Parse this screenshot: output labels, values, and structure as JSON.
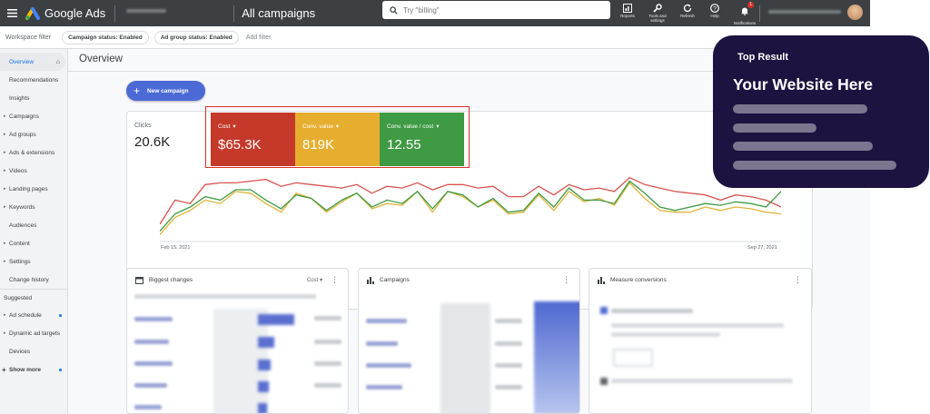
{
  "header": {
    "brand": "Google Ads",
    "page_title": "All campaigns",
    "search_placeholder": "Try \"billing\"",
    "tools": [
      {
        "label": "Reports",
        "icon": "reports-icon"
      },
      {
        "label": "Tools and settings",
        "icon": "wrench-icon"
      },
      {
        "label": "Refresh",
        "icon": "refresh-icon"
      },
      {
        "label": "Help",
        "icon": "help-icon"
      },
      {
        "label": "Notifications",
        "icon": "bell-icon",
        "badge": "1"
      }
    ]
  },
  "filters": {
    "workspace_label": "Workspace filter",
    "chips": [
      "Campaign status: Enabled",
      "Ad group status: Enabled"
    ],
    "add_filter": "Add filter"
  },
  "sidebar": {
    "items": [
      {
        "label": "Overview",
        "selected": true
      },
      {
        "label": "Recommendations"
      },
      {
        "label": "Insights"
      },
      {
        "label": "Campaigns",
        "expandable": true
      },
      {
        "label": "Ad groups",
        "expandable": true
      },
      {
        "label": "Ads & extensions",
        "expandable": true
      },
      {
        "label": "Videos",
        "expandable": true
      },
      {
        "label": "Landing pages",
        "expandable": true
      },
      {
        "label": "Keywords",
        "expandable": true
      },
      {
        "label": "Audiences"
      },
      {
        "label": "Content",
        "expandable": true
      },
      {
        "label": "Settings",
        "expandable": true
      },
      {
        "label": "Change history"
      }
    ],
    "suggested_label": "Suggested",
    "suggested": [
      {
        "label": "Ad schedule",
        "expandable": true
      },
      {
        "label": "Dynamic ad targets",
        "expandable": true
      },
      {
        "label": "Devices"
      }
    ],
    "show_more": "Show more"
  },
  "main": {
    "title": "Overview",
    "new_campaign": "New campaign",
    "clicks": {
      "label": "Clicks",
      "value": "20.6K"
    },
    "metrics": [
      {
        "label": "Cost",
        "value": "$65.3K",
        "color": "#c5392a"
      },
      {
        "label": "Conv. value",
        "value": "819K",
        "color": "#e6ae2f"
      },
      {
        "label": "Conv. value / cost",
        "value": "12.55",
        "color": "#3e9a43"
      }
    ],
    "date_start": "Feb 15, 2021",
    "date_end": "Sep 27, 2021",
    "cards": [
      {
        "title": "Biggest changes",
        "dropdown": "Cost"
      },
      {
        "title": "Campaigns"
      },
      {
        "title": "Measure conversions"
      }
    ]
  },
  "chart_data": {
    "type": "line",
    "x": [
      "Feb 15, 2021",
      "Sep 27, 2021"
    ],
    "series": [
      {
        "name": "Cost",
        "color": "#d9534f",
        "values": [
          70,
          84,
          82,
          93,
          94,
          94,
          95,
          96,
          92,
          94,
          93,
          92,
          91,
          93,
          88,
          92,
          91,
          94,
          90,
          93,
          93,
          91,
          92,
          86,
          86,
          92,
          87,
          93,
          90,
          91,
          89,
          97,
          93,
          91,
          89,
          88,
          87,
          84,
          87,
          86,
          84,
          80
        ]
      },
      {
        "name": "Conv. value",
        "color": "#e0b43a",
        "values": [
          64,
          74,
          78,
          84,
          82,
          89,
          88,
          82,
          77,
          88,
          85,
          77,
          83,
          88,
          79,
          82,
          81,
          89,
          77,
          89,
          86,
          80,
          84,
          76,
          77,
          87,
          78,
          89,
          83,
          85,
          81,
          94,
          85,
          78,
          77,
          77,
          80,
          78,
          80,
          79,
          77,
          76
        ]
      },
      {
        "name": "Conv. value / cost",
        "color": "#3e9a43",
        "values": [
          66,
          76,
          80,
          86,
          84,
          90,
          90,
          84,
          79,
          87,
          85,
          78,
          84,
          88,
          80,
          84,
          82,
          89,
          79,
          89,
          87,
          80,
          85,
          77,
          78,
          88,
          80,
          91,
          84,
          84,
          82,
          95,
          88,
          80,
          78,
          80,
          82,
          81,
          83,
          82,
          80,
          89
        ]
      }
    ]
  },
  "top_result": {
    "label": "Top Result",
    "title": "Your Website Here"
  }
}
